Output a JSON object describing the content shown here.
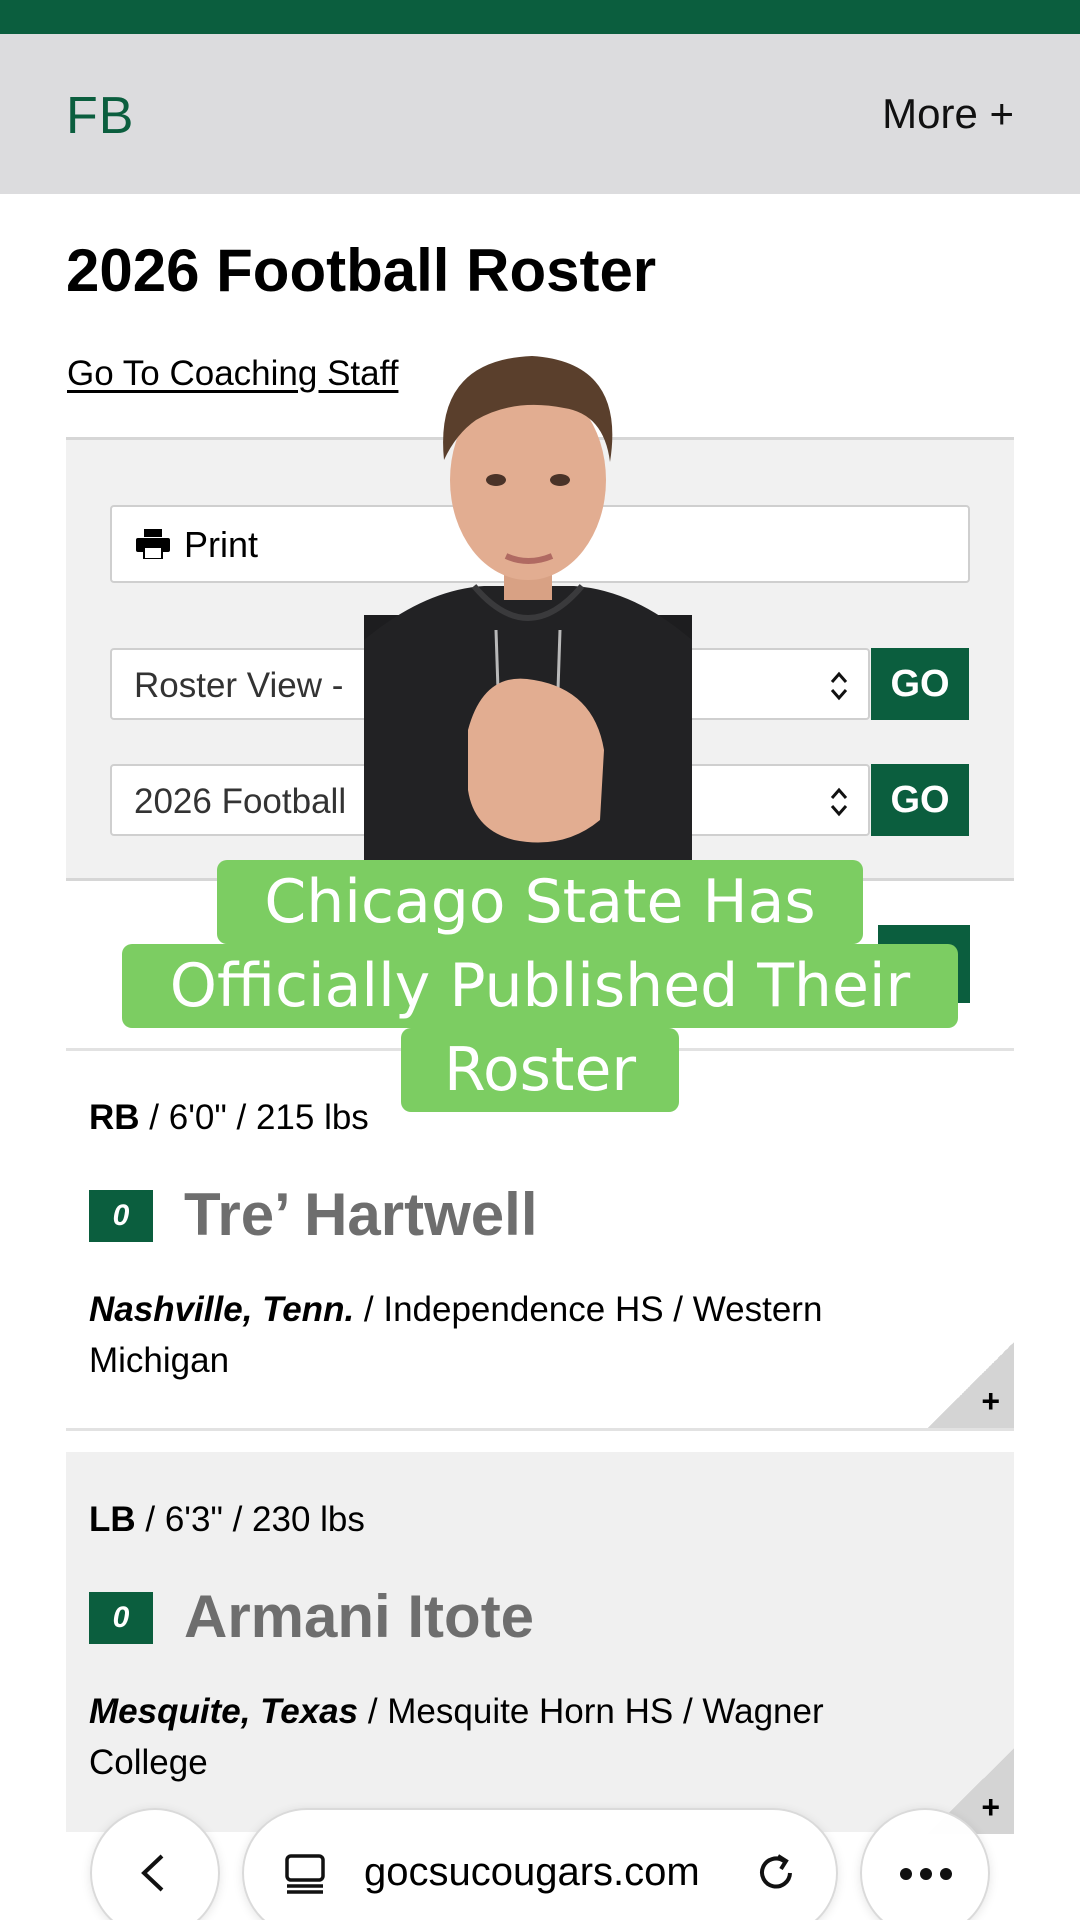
{
  "nav": {
    "brand": "FB",
    "more": "More +"
  },
  "page": {
    "title": "2026 Football Roster",
    "coaching_link": "Go To Coaching Staff"
  },
  "controls": {
    "print_label": "Print",
    "view_select": "Roster View -",
    "season_select": "2026 Football",
    "go_label": "GO"
  },
  "caption": {
    "lines": [
      "Chicago State Has",
      "Officially Published Their",
      "Roster"
    ]
  },
  "players": [
    {
      "position": "RB",
      "stats": " / 6'0\" / 215 lbs",
      "number": "0",
      "name": "Tre’ Hartwell",
      "hometown": "Nashville, Tenn.",
      "details": " / Independence HS / Western Michigan",
      "expand": "+"
    },
    {
      "position": "LB",
      "stats": " / 6'3\" / 230 lbs",
      "number": "0",
      "name": "Armani Itote",
      "hometown": "Mesquite, Texas",
      "details": " / Mesquite Horn HS / Wagner College",
      "expand": "+"
    }
  ],
  "browser": {
    "url": "gocsucougars.com"
  },
  "colors": {
    "brand_green": "#0b5e3e",
    "caption_green": "#7ccd62",
    "nav_gray": "#dcdcde"
  }
}
